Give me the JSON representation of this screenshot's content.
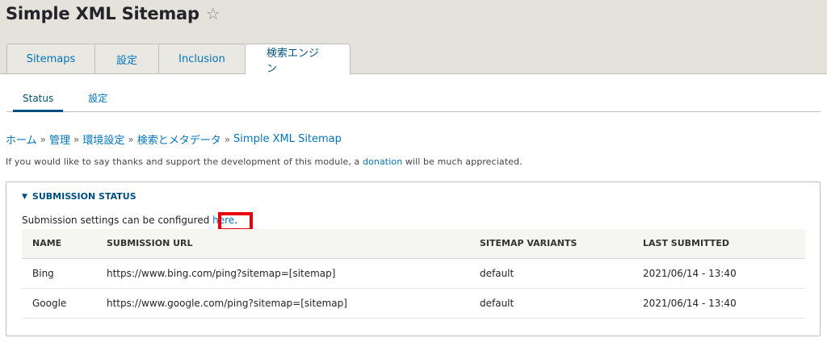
{
  "page": {
    "title": "Simple XML Sitemap",
    "star_glyph": "☆"
  },
  "primary_tabs": [
    {
      "label": "Sitemaps",
      "active": false
    },
    {
      "label": "設定",
      "active": false
    },
    {
      "label": "Inclusion",
      "active": false
    },
    {
      "label": "検索エンジン",
      "active": true
    }
  ],
  "secondary_tabs": [
    {
      "label": "Status",
      "active": true
    },
    {
      "label": "設定",
      "active": false
    }
  ],
  "breadcrumb": [
    {
      "label": "ホーム"
    },
    {
      "label": "管理"
    },
    {
      "label": "環境設定"
    },
    {
      "label": "検索とメタデータ"
    },
    {
      "label": "Simple XML Sitemap"
    }
  ],
  "breadcrumb_separator": "»",
  "notice": {
    "prefix": "If you would like to say thanks and support the development of this module, a ",
    "link": "donation",
    "suffix": " will be much appreciated."
  },
  "submission_status": {
    "summary": "SUBMISSION STATUS",
    "toggle_glyph": "▼",
    "config_prefix": "Submission settings can be configured ",
    "config_link": "here",
    "config_suffix": ".",
    "columns": [
      "NAME",
      "SUBMISSION URL",
      "SITEMAP VARIANTS",
      "LAST SUBMITTED"
    ],
    "rows": [
      {
        "name": "Bing",
        "url": "https://www.bing.com/ping?sitemap=[sitemap]",
        "variants": "default",
        "last": "2021/06/14 - 13:40"
      },
      {
        "name": "Google",
        "url": "https://www.google.com/ping?sitemap=[sitemap]",
        "variants": "default",
        "last": "2021/06/14 - 13:40"
      }
    ]
  },
  "colors": {
    "link": "#0074bd",
    "highlight": "#e8000b",
    "header_bg": "#e4e2db"
  }
}
